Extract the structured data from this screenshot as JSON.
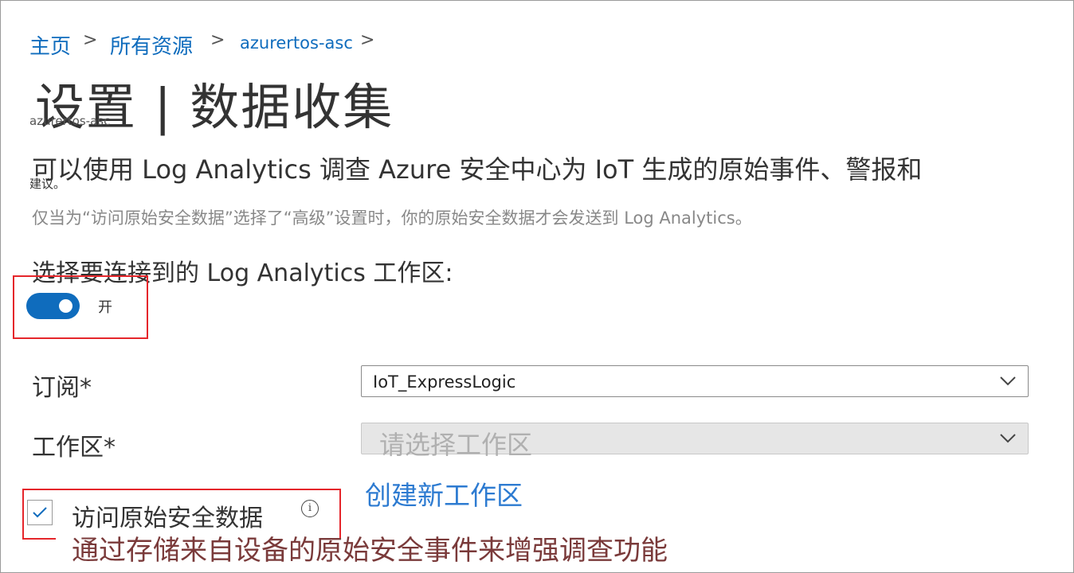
{
  "breadcrumb": {
    "home": "主页",
    "all_resources": "所有资源",
    "resource": "azurertos-asc",
    "separator": ">"
  },
  "page": {
    "title": "设置 |  数据收集",
    "subtitle": "azurertos-asc"
  },
  "description": {
    "main": "可以使用 Log Analytics 调查 Azure 安全中心为 IoT 生成的原始事件、警报和",
    "tail": "建议。",
    "note": "仅当为“访问原始安全数据”选择了“高级”设置时，你的原始安全数据才会发送到 Log Analytics。"
  },
  "workspace_section": {
    "label": "选择要连接到的 Log Analytics 工作区:",
    "toggle_state": "on",
    "toggle_label": "开"
  },
  "form": {
    "subscription_label": "订阅*",
    "subscription_value": "IoT_ExpressLogic",
    "workspace_label": "工作区*",
    "workspace_placeholder": "请选择工作区",
    "create_link": "创建新工作区"
  },
  "raw_data": {
    "checked": true,
    "label": "访问原始安全数据",
    "info_icon": "info-icon",
    "description": "通过存储来自设备的原始安全事件来增强调查功能"
  },
  "colors": {
    "accent": "#0f6cbd",
    "highlight": "#e5262b",
    "link": "#2d7bd1"
  }
}
